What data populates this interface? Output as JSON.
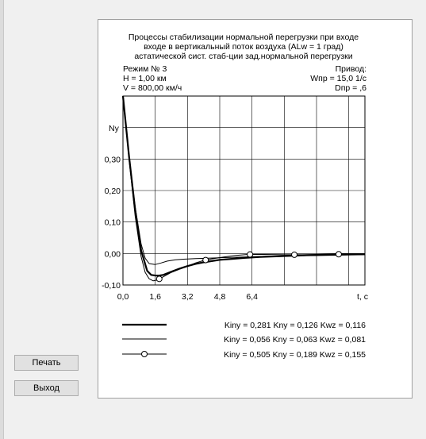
{
  "buttons": {
    "print_label": "Печать",
    "exit_label": "Выход"
  },
  "header": {
    "title_lines": [
      "Процессы стабилизации нормальной перегрузки при входе",
      "входе в вертикальный поток воздуха (ALw = 1 град)",
      "астатической сист. стаб-ции зад.нормальной перегрузки"
    ],
    "left_info": [
      "Режим № 3",
      "H = 1,00 км",
      "V = 800,00 км/ч"
    ],
    "right_info": [
      "Привод:",
      "Wпр = 15,0  1/с",
      "Dпр = ,6"
    ]
  },
  "chart_data": {
    "type": "line",
    "ylabel": "Ny",
    "xlabel": "t, c",
    "xlim": [
      0,
      12
    ],
    "ylim": [
      -0.1,
      0.5
    ],
    "x_ticks": [
      0,
      1.6,
      3.2,
      4.8,
      6.4
    ],
    "x_tick_labels": [
      "0,0",
      "1,6",
      "3,2",
      "4,8",
      "6,4"
    ],
    "y_ticks": [
      -0.1,
      0.0,
      0.1,
      0.2,
      0.3
    ],
    "y_tick_labels": [
      "-0,10",
      "0,00",
      "0,10",
      "0,20",
      "0,30"
    ],
    "grid": true,
    "legend": "bottom",
    "series": [
      {
        "name": "Kiny = 0,281 Kny = 0,126 Kwz = 0,116",
        "style": "thick",
        "x": [
          0,
          0.3,
          0.6,
          0.9,
          1.2,
          1.4,
          1.6,
          1.8,
          2.0,
          2.4,
          2.8,
          3.2,
          3.6,
          4.0,
          4.4,
          4.8,
          5.4,
          6.0,
          6.8,
          7.6,
          8.4,
          9.2,
          10.0,
          11.0,
          12.0
        ],
        "y": [
          0.5,
          0.31,
          0.14,
          0.01,
          -0.055,
          -0.068,
          -0.07,
          -0.07,
          -0.068,
          -0.058,
          -0.048,
          -0.04,
          -0.033,
          -0.028,
          -0.024,
          -0.02,
          -0.017,
          -0.014,
          -0.011,
          -0.009,
          -0.007,
          -0.005,
          -0.004,
          -0.003,
          -0.002
        ]
      },
      {
        "name": "Kiny = 0,056 Kny = 0,063 Kwz = 0,081",
        "style": "thin",
        "x": [
          0,
          0.3,
          0.6,
          0.9,
          1.1,
          1.3,
          1.6,
          1.9,
          2.2,
          2.6,
          3.0,
          3.6,
          4.2,
          5.0,
          6.0,
          7.0,
          8.0,
          9.0,
          10.0,
          11.0,
          12.0
        ],
        "y": [
          0.5,
          0.31,
          0.15,
          0.03,
          -0.015,
          -0.032,
          -0.035,
          -0.03,
          -0.024,
          -0.02,
          -0.018,
          -0.016,
          -0.015,
          -0.013,
          -0.011,
          -0.009,
          -0.008,
          -0.007,
          -0.006,
          -0.005,
          -0.004
        ]
      },
      {
        "name": "Kiny = 0,505 Kny = 0,189 Kwz = 0,155",
        "style": "circle",
        "x": [
          0,
          0.3,
          0.6,
          0.9,
          1.1,
          1.3,
          1.5,
          1.7,
          2.0,
          2.4,
          2.8,
          3.2,
          3.6,
          4.0,
          4.4,
          5.0,
          5.6,
          6.2,
          7.0,
          8.0,
          9.0,
          10.0,
          11.0,
          12.0
        ],
        "y": [
          0.5,
          0.3,
          0.12,
          -0.01,
          -0.06,
          -0.08,
          -0.087,
          -0.084,
          -0.074,
          -0.06,
          -0.05,
          -0.04,
          -0.03,
          -0.022,
          -0.017,
          -0.011,
          -0.006,
          -0.003,
          -0.003,
          -0.004,
          -0.004,
          -0.003,
          -0.002,
          -0.002
        ],
        "markers_x": [
          1.8,
          4.1,
          6.3,
          8.5,
          10.7
        ]
      }
    ]
  }
}
